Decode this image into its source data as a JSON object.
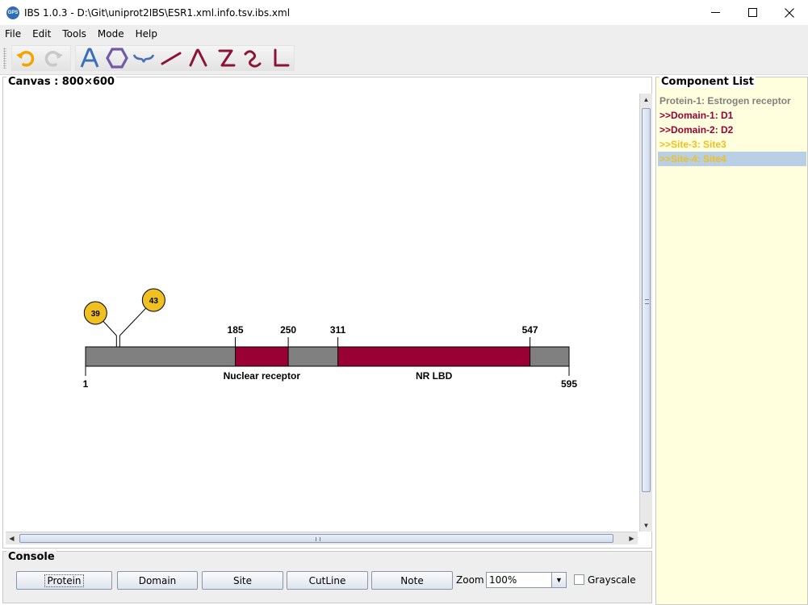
{
  "window": {
    "app_icon_text": "GPS",
    "title": "IBS 1.0.3 - D:\\Git\\uniprot2IBS\\ESR1.xml.info.tsv.ibs.xml",
    "controls": {
      "minimize": "—",
      "maximize": "☐",
      "close": "✕"
    }
  },
  "menu": {
    "items": [
      {
        "label": "File"
      },
      {
        "label": "Edit"
      },
      {
        "label": "Tools"
      },
      {
        "label": "Mode"
      },
      {
        "label": "Help"
      }
    ]
  },
  "toolbar": {
    "history_tools": [
      "undo-icon",
      "redo-icon"
    ],
    "draw_tools": [
      "text-tool-icon",
      "hexagon-tool-icon",
      "brace-tool-icon",
      "line-tool-icon",
      "peak-tool-icon",
      "z-shape-tool-icon",
      "curve-tool-icon",
      "l-shape-tool-icon"
    ],
    "colors": {
      "undo": "#f0a500",
      "text": "#3d6fb6",
      "shapes": "#8a1438"
    }
  },
  "canvas": {
    "title": "Canvas : 800×600",
    "protein": {
      "start": 1,
      "end": 595,
      "start_label": "1",
      "end_label": "595",
      "color": "#808080"
    },
    "domains": [
      {
        "start": 185,
        "end": 250,
        "start_label": "185",
        "end_label": "250",
        "name": "Nuclear receptor",
        "color": "#990033"
      },
      {
        "start": 311,
        "end": 547,
        "start_label": "311",
        "end_label": "547",
        "name": "NR LBD",
        "color": "#990033"
      }
    ],
    "sites": [
      {
        "position": 39,
        "label": "39",
        "color": "#f0c020"
      },
      {
        "position": 43,
        "label": "43",
        "color": "#f0c020"
      }
    ]
  },
  "component_list": {
    "title": "Component List",
    "items": [
      {
        "text": "Protein-1: Estrogen receptor",
        "color": "#808080",
        "selected": false
      },
      {
        "text": ">>Domain-1: D1",
        "color": "#990033",
        "selected": false
      },
      {
        "text": ">>Domain-2: D2",
        "color": "#990033",
        "selected": false
      },
      {
        "text": ">>Site-3: Site3",
        "color": "#f0c020",
        "selected": false
      },
      {
        "text": ">>Site-4: Site4",
        "color": "#f0c020",
        "selected": true
      }
    ]
  },
  "console": {
    "title": "Console",
    "buttons": {
      "protein": "Protein",
      "domain": "Domain",
      "site": "Site",
      "cutline": "CutLine",
      "note": "Note"
    },
    "zoom_label": "Zoom",
    "zoom_value": "100%",
    "grayscale_label": "Grayscale",
    "grayscale_checked": false
  }
}
